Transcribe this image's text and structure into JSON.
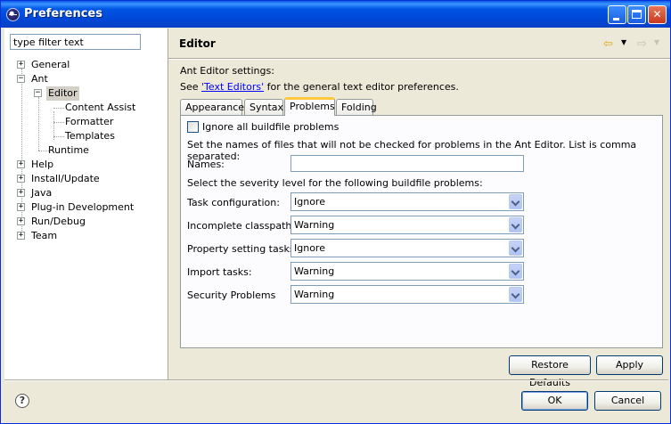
{
  "window": {
    "title": "Preferences"
  },
  "filter": {
    "value": "type filter text"
  },
  "tree": {
    "general": "General",
    "ant": "Ant",
    "editor": "Editor",
    "content_assist": "Content Assist",
    "formatter": "Formatter",
    "templates": "Templates",
    "runtime": "Runtime",
    "help": "Help",
    "install_update": "Install/Update",
    "java": "Java",
    "plugin_dev": "Plug-in Development",
    "run_debug": "Run/Debug",
    "team": "Team"
  },
  "page": {
    "title": "Editor",
    "intro": "Ant Editor settings:",
    "see_prefix": "See ",
    "see_link": "'Text Editors'",
    "see_suffix": " for the general text editor preferences."
  },
  "tabs": [
    "Appearance",
    "Syntax",
    "Problems",
    "Folding"
  ],
  "problems": {
    "ignore_all_label": "Ignore all buildfile problems",
    "ignore_all_checked": false,
    "names_desc": "Set the names of files that will not be checked for problems in the Ant Editor. List is comma separated:",
    "names_label": "Names:",
    "names_value": "",
    "severity_desc": "Select the severity level for the following buildfile problems:",
    "rows": [
      {
        "label": "Task configuration:",
        "value": "Ignore"
      },
      {
        "label": "Incomplete classpath:",
        "value": "Warning"
      },
      {
        "label": "Property setting tasks:",
        "value": "Ignore"
      },
      {
        "label": "Import tasks:",
        "value": "Warning"
      },
      {
        "label": "Security Problems",
        "value": "Warning"
      }
    ]
  },
  "buttons": {
    "restore_defaults": "Restore Defaults",
    "apply": "Apply",
    "ok": "OK",
    "cancel": "Cancel"
  },
  "icons": {
    "help": "?"
  }
}
